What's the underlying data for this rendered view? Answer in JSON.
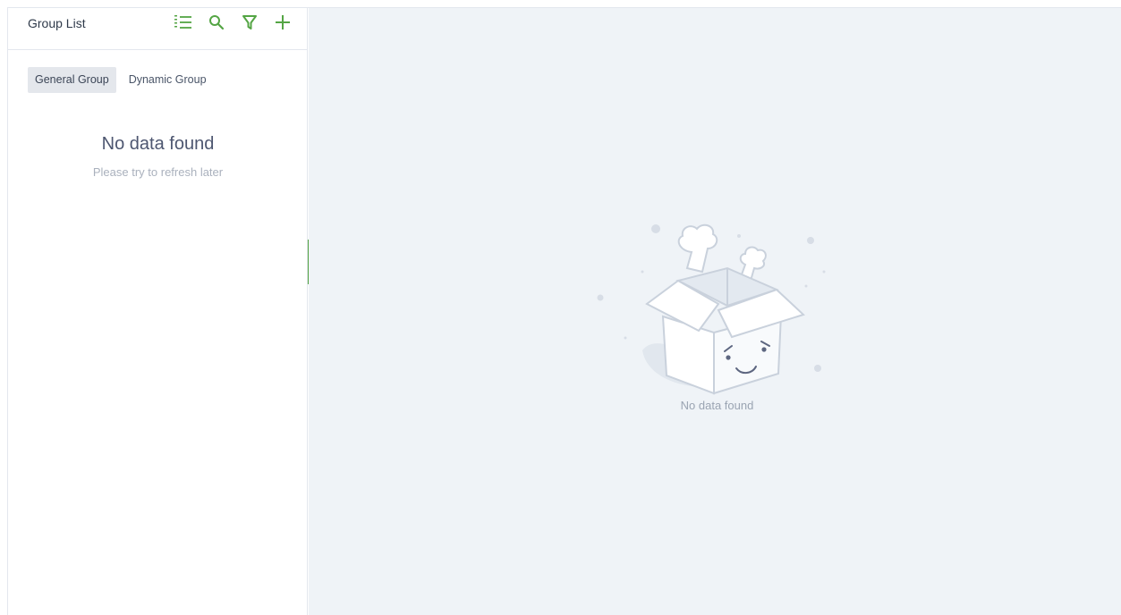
{
  "sidebar": {
    "title": "Group List",
    "tools": [
      {
        "icon": "sort-list-icon"
      },
      {
        "icon": "search-icon"
      },
      {
        "icon": "filter-icon"
      },
      {
        "icon": "plus-icon"
      }
    ],
    "tabs": [
      {
        "label": "General Group",
        "active": true
      },
      {
        "label": "Dynamic Group",
        "active": false
      }
    ],
    "empty_title": "No data found",
    "empty_subtitle": "Please try to refresh later"
  },
  "collapse_handle": {
    "icon": "chevron-left-icon",
    "glyph": "‹"
  },
  "main": {
    "empty_text": "No data found",
    "illustration": "empty-box-icon"
  },
  "colors": {
    "accent": "#54a544",
    "main_bg": "#eff3f7",
    "border": "#e3e7ee"
  }
}
